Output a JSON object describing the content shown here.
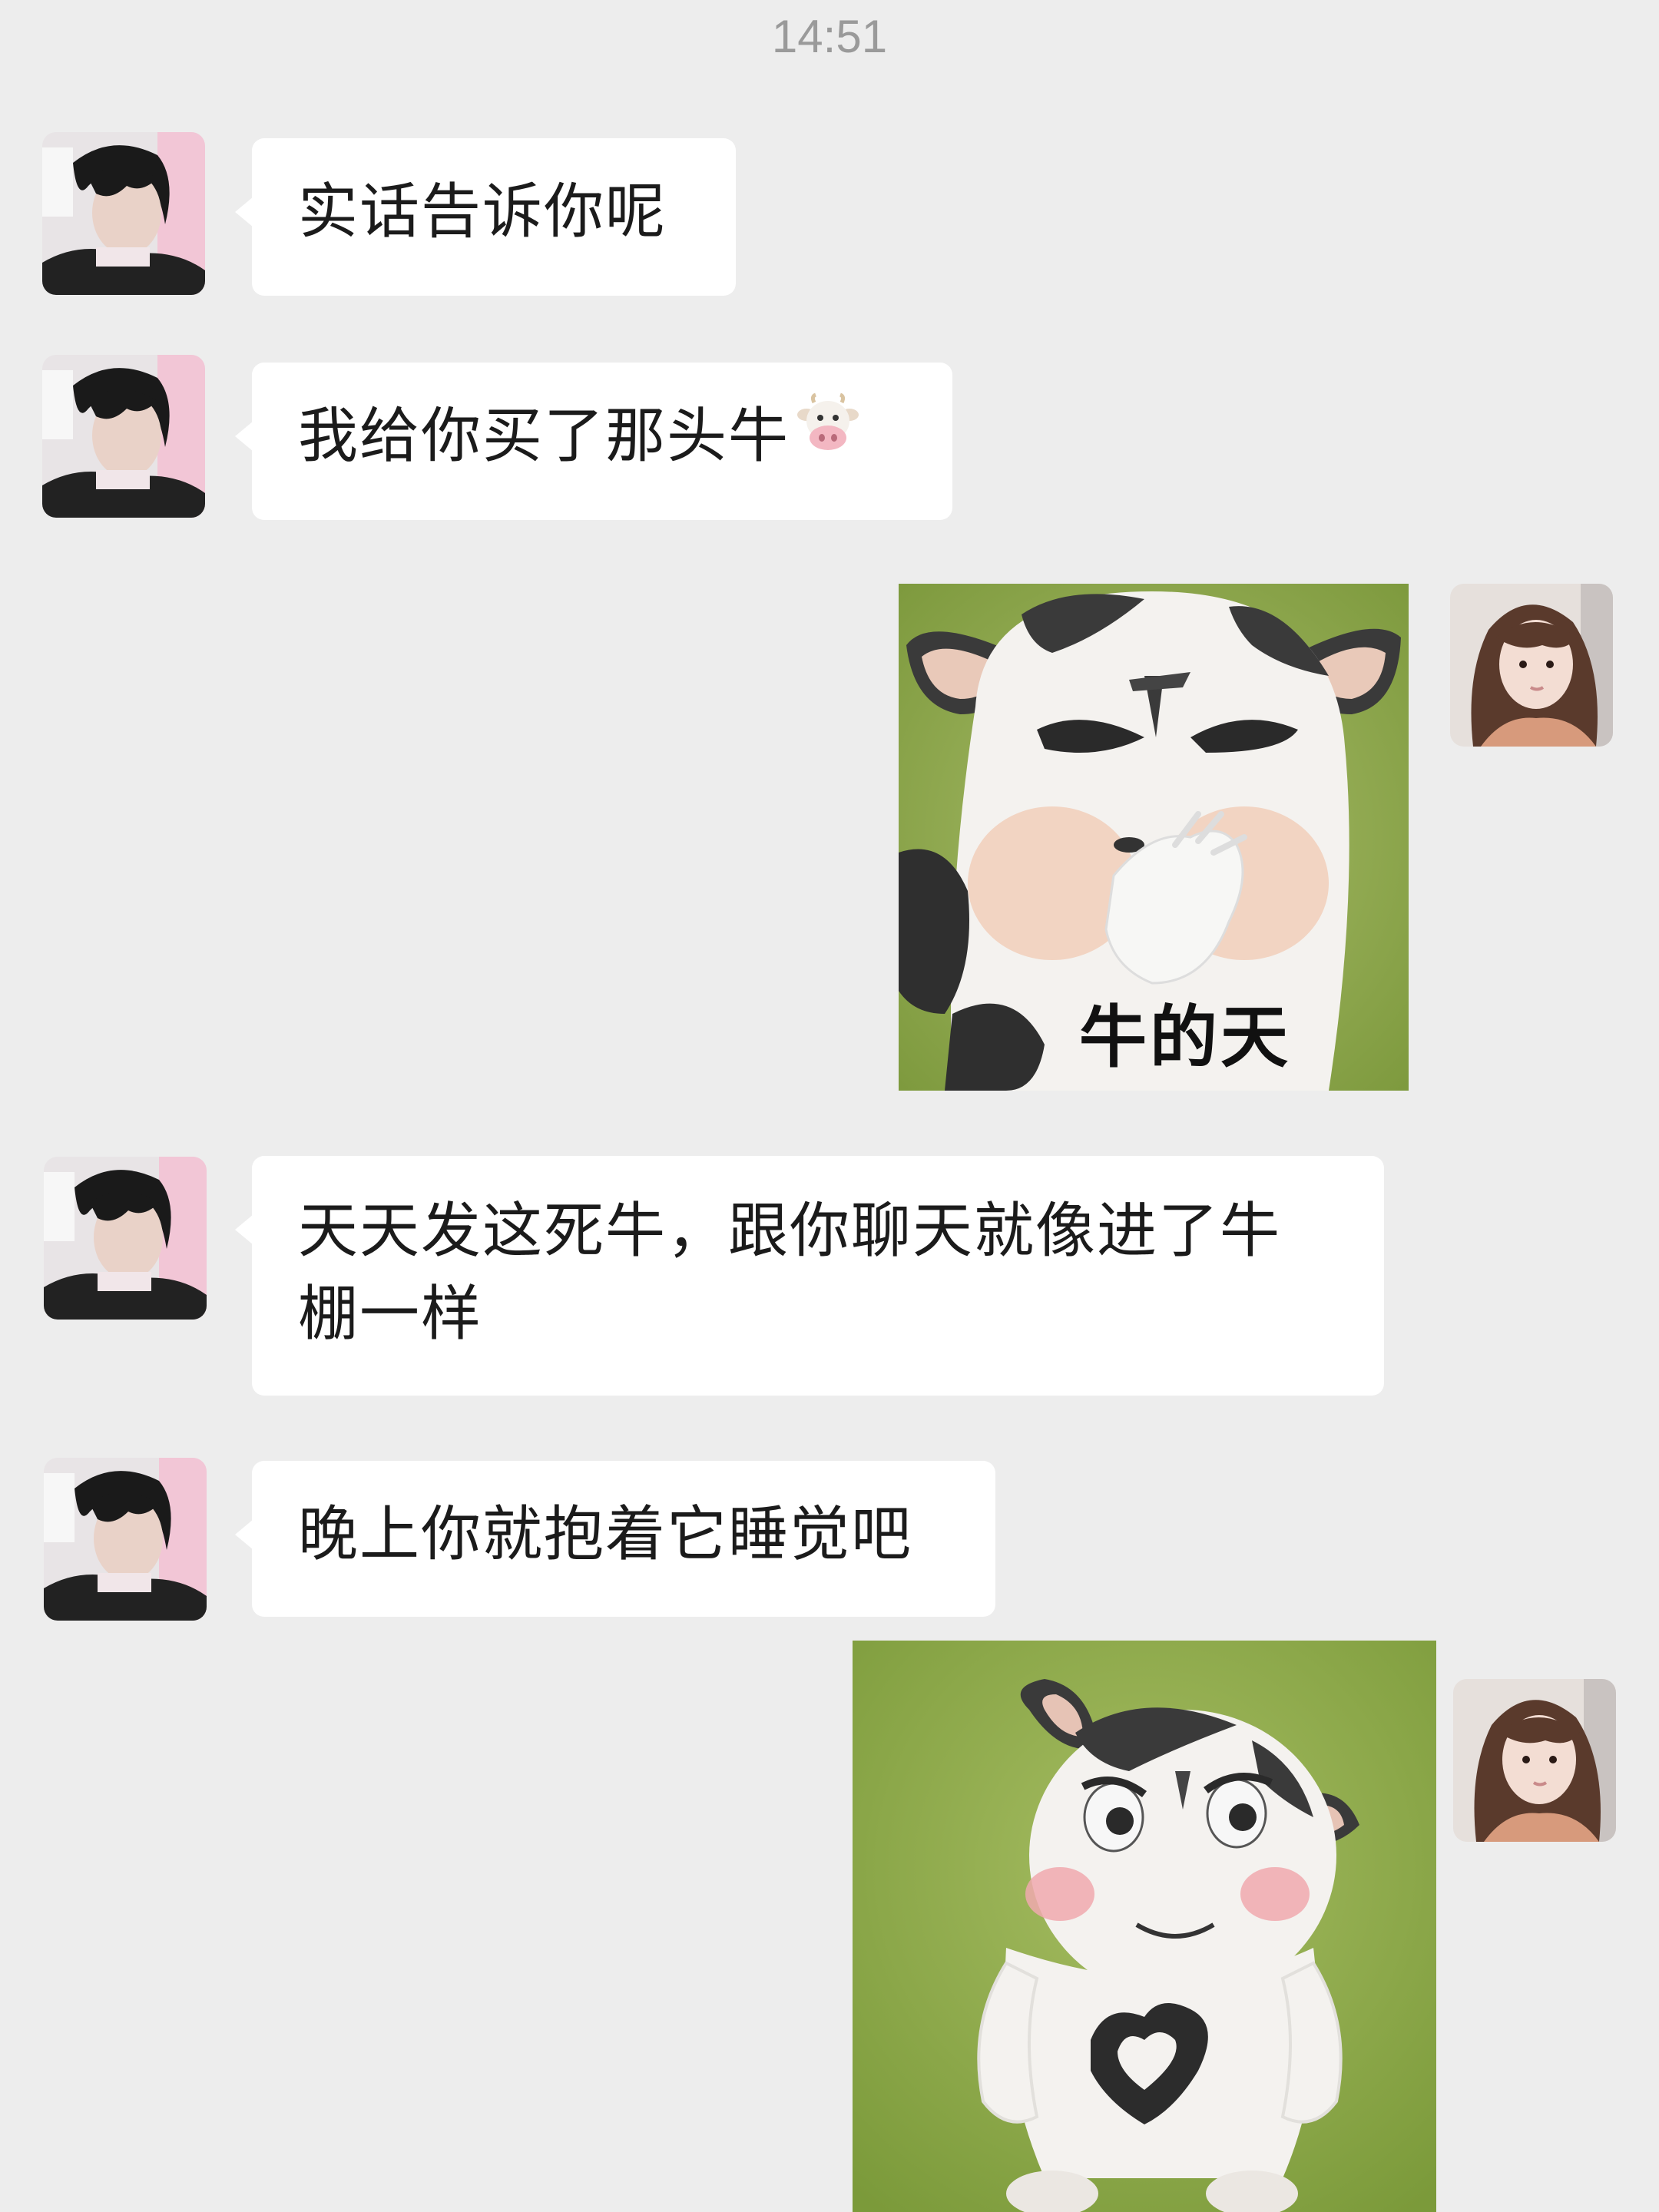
{
  "status": {
    "time": "14:51"
  },
  "messages": [
    {
      "sender": "contact",
      "type": "text",
      "text": "实话告诉你呢"
    },
    {
      "sender": "contact",
      "type": "text",
      "text": "我给你买了那头牛",
      "emoji": "cow-face-emoji"
    },
    {
      "sender": "me",
      "type": "sticker",
      "caption": "牛的天",
      "icon": "cow-sticker-angry"
    },
    {
      "sender": "contact",
      "type": "text",
      "text": "天天发这死牛，跟你聊天就像进了牛棚一样"
    },
    {
      "sender": "contact",
      "type": "text",
      "text": "晚上你就抱着它睡觉吧"
    },
    {
      "sender": "me",
      "type": "sticker",
      "caption": "",
      "icon": "cow-sticker-heart"
    }
  ],
  "colors": {
    "background": "#ededed",
    "bubble_incoming": "#ffffff",
    "text": "#1b1b1b",
    "timestamp": "#9a9a9a",
    "sticker_grass": "#8aa84a"
  }
}
